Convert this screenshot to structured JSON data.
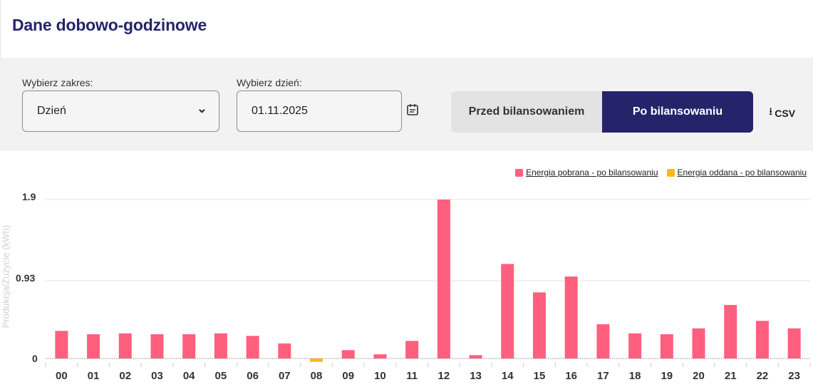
{
  "header": {
    "title": "Dane dobowo-godzinowe"
  },
  "filters": {
    "range_label": "Wybierz zakres:",
    "range_value": "Dzień",
    "day_label": "Wybierz dzień:",
    "day_value": "01.11.2025",
    "toggle_before": "Przed bilansowaniem",
    "toggle_after": "Po bilansowaniu",
    "csv_label": "CSV"
  },
  "colors": {
    "consumed": "#ff5f7e",
    "produced": "#ffb51e",
    "brand": "#25246b"
  },
  "icons": {
    "calendar": "calendar-icon",
    "chevron": "chevron-down-icon",
    "download": "download-icon"
  },
  "chart_data": {
    "type": "bar",
    "title": "",
    "ylabel": "Produkcja/Zużycie (kWh)",
    "y_ticks": [
      "1.9",
      "0.93",
      "0"
    ],
    "ylim": [
      0,
      1.9
    ],
    "legend_position": "top-right",
    "categories": [
      "00",
      "01",
      "02",
      "03",
      "04",
      "05",
      "06",
      "07",
      "08",
      "09",
      "10",
      "11",
      "12",
      "13",
      "14",
      "15",
      "16",
      "17",
      "18",
      "19",
      "20",
      "21",
      "22",
      "23"
    ],
    "series": [
      {
        "name": "Energia pobrana - po bilansowaniu",
        "values": [
          0.33,
          0.29,
          0.3,
          0.29,
          0.29,
          0.3,
          0.27,
          0.18,
          0,
          0.1,
          0.05,
          0.21,
          1.9,
          0.04,
          1.13,
          0.79,
          0.98,
          0.41,
          0.3,
          0.29,
          0.36,
          0.64,
          0.45,
          0.36
        ]
      },
      {
        "name": "Energia oddana - po bilansowaniu",
        "values": [
          0,
          0,
          0,
          0,
          0,
          0,
          0,
          0,
          0.04,
          0,
          0,
          0,
          0,
          0,
          0,
          0,
          0,
          0,
          0,
          0,
          0,
          0,
          0,
          0
        ]
      }
    ]
  }
}
